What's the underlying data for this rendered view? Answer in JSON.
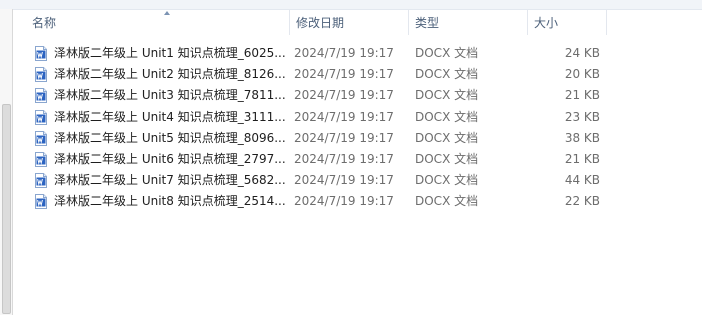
{
  "header": {
    "columns": [
      "名称",
      "修改日期",
      "类型",
      "大小"
    ]
  },
  "files": [
    {
      "name": "泽林版二年级上 Unit1 知识点梳理_6025...",
      "date": "2024/7/19 19:17",
      "type": "DOCX 文档",
      "size": "24 KB",
      "icon": "word-doc-icon"
    },
    {
      "name": "泽林版二年级上 Unit2 知识点梳理_8126...",
      "date": "2024/7/19 19:17",
      "type": "DOCX 文档",
      "size": "20 KB",
      "icon": "word-doc-icon"
    },
    {
      "name": "泽林版二年级上 Unit3 知识点梳理_7811...",
      "date": "2024/7/19 19:17",
      "type": "DOCX 文档",
      "size": "21 KB",
      "icon": "word-doc-icon"
    },
    {
      "name": "泽林版二年级上 Unit4 知识点梳理_3111...",
      "date": "2024/7/19 19:17",
      "type": "DOCX 文档",
      "size": "23 KB",
      "icon": "word-doc-icon"
    },
    {
      "name": "泽林版二年级上 Unit5 知识点梳理_8096...",
      "date": "2024/7/19 19:17",
      "type": "DOCX 文档",
      "size": "38 KB",
      "icon": "word-doc-icon"
    },
    {
      "name": "泽林版二年级上 Unit6 知识点梳理_2797...",
      "date": "2024/7/19 19:17",
      "type": "DOCX 文档",
      "size": "21 KB",
      "icon": "word-doc-icon"
    },
    {
      "name": "泽林版二年级上 Unit7 知识点梳理_5682...",
      "date": "2024/7/19 19:17",
      "type": "DOCX 文档",
      "size": "44 KB",
      "icon": "word-doc-icon"
    },
    {
      "name": "泽林版二年级上 Unit8 知识点梳理_2514...",
      "date": "2024/7/19 19:17",
      "type": "DOCX 文档",
      "size": "22 KB",
      "icon": "word-doc-icon"
    }
  ],
  "colors": {
    "header_text": "#4c607a",
    "icon_blue": "#2b63c1",
    "meta_text": "#6d6d6d"
  }
}
